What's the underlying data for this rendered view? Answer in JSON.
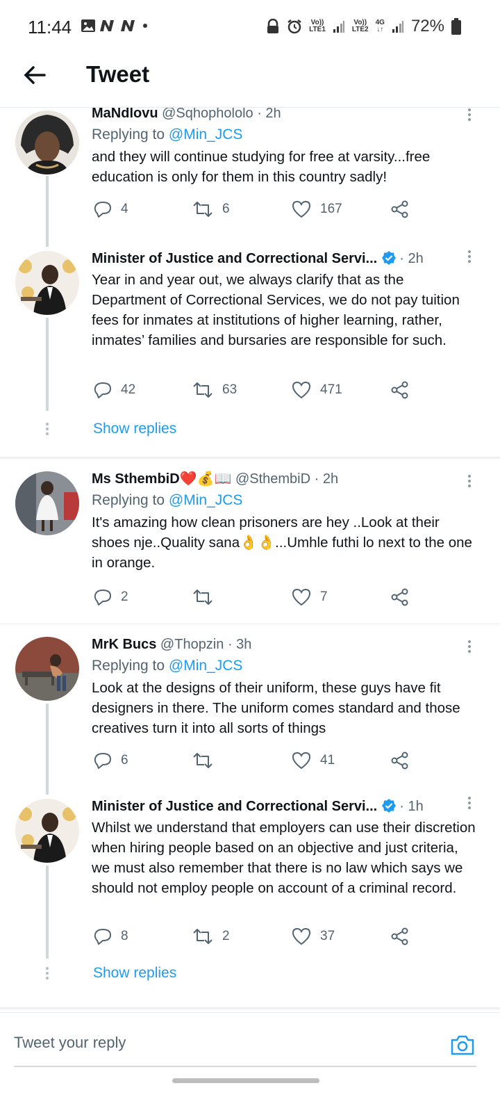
{
  "status_bar": {
    "time": "11:44",
    "net1": "Vo))\nLTE1",
    "net2": "Vo))\nLTE2",
    "net3": "4G",
    "battery": "72%"
  },
  "header": {
    "title": "Tweet"
  },
  "tweets": [
    {
      "name": "MaNdlovu",
      "handle": "@Sqhophololo",
      "time": "· 2h",
      "reply_label": "Replying to",
      "reply_to": "@Min_JCS",
      "text": "and they will continue studying for free at varsity...free education is only for them in this country sadly!",
      "replies": "4",
      "retweets": "6",
      "likes": "167"
    },
    {
      "name": "Minister of Justice and Correctional Servi...",
      "handle": "",
      "time": "· 2h",
      "text": "Year in and year out, we always clarify that as the Department of Correctional Services, we do not pay tuition fees for inmates at institutions of higher learning, rather, inmates’ families and bursaries are responsible for such.",
      "replies": "42",
      "retweets": "63",
      "likes": "471",
      "show_replies": "Show replies"
    },
    {
      "name": "Ms SthembiD❤️💰📖",
      "handle": "@SthembiD",
      "time": "· 2h",
      "reply_label": "Replying to",
      "reply_to": "@Min_JCS",
      "text": "It's amazing how clean prisoners are hey ..Look at their shoes nje..Quality sana👌👌...Umhle futhi lo next to the one in orange.",
      "replies": "2",
      "retweets": "",
      "likes": "7"
    },
    {
      "name": "MrK Bucs",
      "handle": "@Thopzin",
      "time": "· 3h",
      "reply_label": "Replying to",
      "reply_to": "@Min_JCS",
      "text": "Look at the designs of their uniform, these guys have fit designers in there. The uniform comes standard and those creatives turn it into all sorts of things",
      "replies": "6",
      "retweets": "",
      "likes": "41"
    },
    {
      "name": "Minister of Justice and Correctional Servi...",
      "handle": "",
      "time": "· 1h",
      "text": "Whilst we understand that employers can use their discretion when hiring people based on an objective and just criteria, we must also remember that there is no law which says we should not employ people on account of a criminal record.",
      "replies": "8",
      "retweets": "2",
      "likes": "37",
      "show_replies": "Show replies"
    }
  ],
  "composer": {
    "placeholder": "Tweet your reply"
  },
  "colors": {
    "accent": "#1d9bf0",
    "text": "#0f1419",
    "muted": "#536471"
  }
}
